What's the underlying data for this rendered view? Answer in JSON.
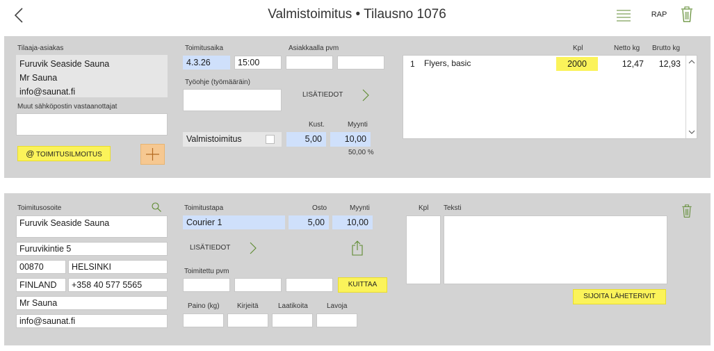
{
  "header": {
    "title": "Valmistoimitus • Tilausno 1076",
    "rap_label": "RAP"
  },
  "customer": {
    "label": "Tilaaja-asiakas",
    "lines": [
      "Furuvik Seaside Sauna",
      "Mr Sauna",
      "info@saunat.fi"
    ],
    "other_recipients_label": "Muut sähköpostin vastaanottajat",
    "other_recipients_value": "",
    "notify_button": "TOIMITUSILMOITUS",
    "notify_icon": "@"
  },
  "delivery_time": {
    "label": "Toimitusaika",
    "date": "4.3.26",
    "time": "15:00",
    "customer_date_label": "Asiakkaalla pvm",
    "work_instructions_label": "Työohje (työmääräin)",
    "more_info_label": "LISÄTIEDOT",
    "cost_label": "Kust.",
    "sale_label": "Myynti",
    "product_label": "Valmistoimitus",
    "cost_value": "5,00",
    "sale_value": "10,00",
    "margin": "50,00 %"
  },
  "items": {
    "headers": {
      "qty": "Kpl",
      "net": "Netto kg",
      "gross": "Brutto kg"
    },
    "rows": [
      {
        "no": "1",
        "name": "Flyers, basic",
        "qty": "2000",
        "net": "12,47",
        "gross": "12,93"
      }
    ]
  },
  "address": {
    "label": "Toimitusosoite",
    "name": "Furuvik Seaside Sauna",
    "street": "Furuvikintie 5",
    "postal": "00870",
    "city": "HELSINKI",
    "country": "FINLAND",
    "phone": "+358 40 577 5565",
    "contact": "Mr Sauna",
    "email": "info@saunat.fi"
  },
  "shipping": {
    "method_label": "Toimitustapa",
    "purchase_label": "Osto",
    "sale_label": "Myynti",
    "method": "Courier 1",
    "purchase": "5,00",
    "sale": "10,00",
    "more_info_label": "LISÄTIEDOT",
    "delivered_date_label": "Toimitettu pvm",
    "acknowledge_button": "KUITTAA",
    "weight_label": "Paino (kg)",
    "letters_label": "Kirjeitä",
    "boxes_label": "Laatikoita",
    "pallets_label": "Lavoja"
  },
  "notes": {
    "qty_label": "Kpl",
    "text_label": "Teksti",
    "place_button": "SIJOITA LÄHETERIVIT"
  },
  "colors": {
    "panel": "#d3d3d3",
    "yellow": "#fbf35a",
    "blue_field": "#cfe0fb",
    "orange": "#f6c891",
    "icon_green": "#5d8a2f"
  }
}
